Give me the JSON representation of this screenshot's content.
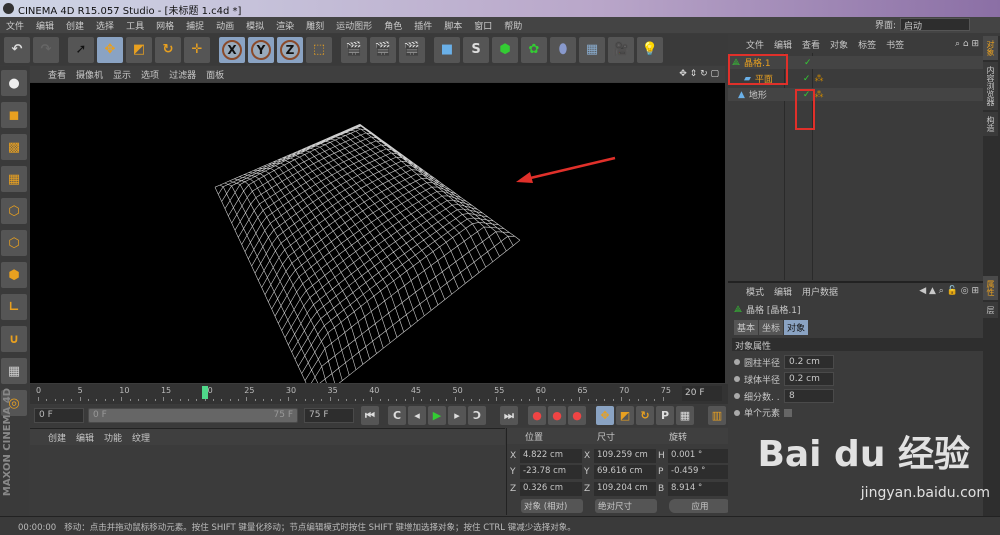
{
  "window": {
    "title": "CINEMA 4D R15.057 Studio - [未标题 1.c4d *]"
  },
  "menu": [
    "文件",
    "编辑",
    "创建",
    "选择",
    "工具",
    "网格",
    "捕捉",
    "动画",
    "模拟",
    "渲染",
    "雕刻",
    "运动图形",
    "角色",
    "插件",
    "脚本",
    "窗口",
    "帮助"
  ],
  "layout_selector": {
    "label": "界面:",
    "value": "启动"
  },
  "toolbar": {
    "axes": [
      "X",
      "Y",
      "Z"
    ]
  },
  "viewport": {
    "menu": [
      "查看",
      "摄像机",
      "显示",
      "选项",
      "过滤器",
      "面板"
    ]
  },
  "timeline": {
    "ticks": [
      0,
      5,
      10,
      15,
      20,
      25,
      30,
      35,
      40,
      45,
      50,
      55,
      60,
      65,
      70,
      75
    ],
    "current_frame": 20,
    "end_display": "20 F"
  },
  "controls": {
    "start": "0 F",
    "range_start": "0 F",
    "range_end": "75 F",
    "end": "75 F"
  },
  "material_panel": {
    "menu": [
      "创建",
      "编辑",
      "功能",
      "纹理"
    ]
  },
  "coords": {
    "headers": [
      "位置",
      "尺寸",
      "旋转"
    ],
    "rows": [
      {
        "a": "X",
        "pos": "4.822 cm",
        "s": "X",
        "size": "109.259 cm",
        "r": "H",
        "rot": "0.001 °"
      },
      {
        "a": "Y",
        "pos": "-23.78 cm",
        "s": "Y",
        "size": "69.616 cm",
        "r": "P",
        "rot": "-0.459 °"
      },
      {
        "a": "Z",
        "pos": "0.326 cm",
        "s": "Z",
        "size": "109.204 cm",
        "r": "B",
        "rot": "8.914 °"
      }
    ],
    "mode": "对象 (相对)",
    "size_mode": "绝对尺寸",
    "apply": "应用"
  },
  "object_manager": {
    "menu": [
      "文件",
      "编辑",
      "查看",
      "对象",
      "标签",
      "书签"
    ],
    "objects": [
      {
        "name": "晶格.1",
        "level": 0
      },
      {
        "name": "平面",
        "level": 1
      },
      {
        "name": "地形",
        "level": 0
      }
    ]
  },
  "attributes": {
    "menu": [
      "模式",
      "编辑",
      "用户数据"
    ],
    "object_title": "晶格 [晶格.1]",
    "tabs": [
      "基本",
      "坐标",
      "对象"
    ],
    "section": "对象属性",
    "fields": [
      {
        "label": "圆柱半径",
        "value": "0.2 cm"
      },
      {
        "label": "球体半径",
        "value": "0.2 cm"
      },
      {
        "label": "细分数. .",
        "value": "8"
      }
    ],
    "checkbox_label": "单个元素"
  },
  "side_tabs": [
    "对象",
    "内容浏览器",
    "构造",
    "属性",
    "层"
  ],
  "status": {
    "time": "00:00:00",
    "message": "移动：点击并拖动鼠标移动元素。按住 SHIFT 键量化移动；节点编辑模式时按住 SHIFT 键增加选择对象；按住 CTRL 键减少选择对象。"
  },
  "watermark": {
    "brand": "Bai du 经验",
    "url": "jingyan.baidu.com"
  },
  "colors": {
    "accent": "#e8a020",
    "active": "#8aa3c3",
    "annotation": "#e0302a",
    "frame": "#4fd88a"
  }
}
